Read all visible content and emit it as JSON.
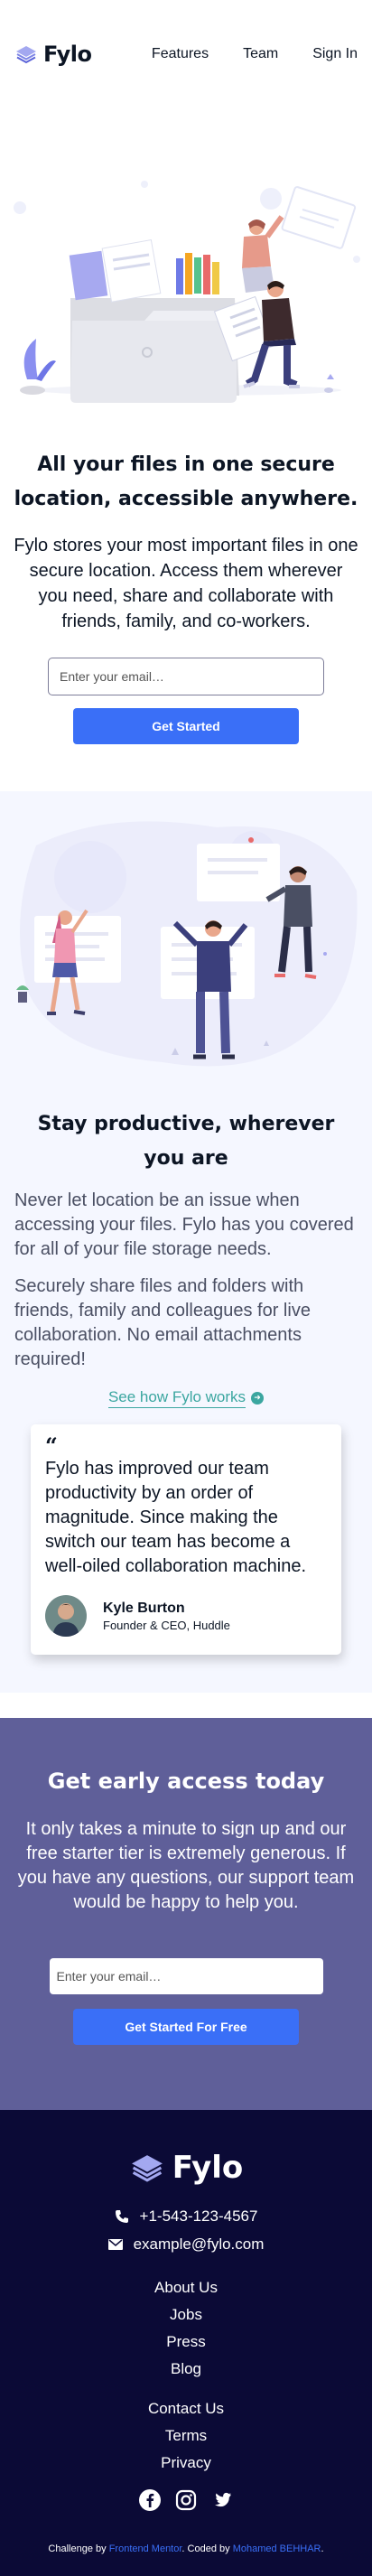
{
  "header": {
    "logo_text": "Fylo",
    "nav": [
      "Features",
      "Team",
      "Sign In"
    ]
  },
  "hero": {
    "title": "All your files in one secure location, accessible anywhere.",
    "body": "Fylo stores your most important files in one secure location. Access them wherever you need, share and collaborate with friends, family, and co-workers.",
    "email_placeholder": "Enter your email…",
    "cta": "Get Started"
  },
  "productive": {
    "title": "Stay productive, wherever you are",
    "p1": "Never let location be an issue when accessing your files. Fylo has you covered for all of your file storage needs.",
    "p2": "Securely share files and folders with friends, family and colleagues for live collaboration. No email attachments required!",
    "link": "See how Fylo works",
    "testimonial": {
      "quote_mark": "“",
      "quote": "Fylo has improved our team productivity by an order of magnitude. Since making the switch our team has become a well-oiled collaboration machine.",
      "name": "Kyle Burton",
      "role": "Founder & CEO, Huddle"
    }
  },
  "early": {
    "title": "Get early access today",
    "body": "It only takes a minute to sign up and our free starter tier is extremely generous. If you have any questions, our support team would be happy to help you.",
    "email_placeholder": "Enter your email…",
    "cta": "Get Started For Free"
  },
  "footer": {
    "logo_text": "Fylo",
    "phone": "+1-543-123-4567",
    "email": "example@fylo.com",
    "links1": [
      "About Us",
      "Jobs",
      "Press",
      "Blog"
    ],
    "links2": [
      "Contact Us",
      "Terms",
      "Privacy"
    ],
    "credit_prefix": "Challenge by ",
    "credit_link1": "Frontend Mentor",
    "credit_middle": ". Coded by ",
    "credit_link2": "Mohamed BEHHAR",
    "credit_suffix": "."
  },
  "colors": {
    "accent_blue": "#3a6ff7",
    "teal": "#3ba6a0",
    "early_bg": "#5f5f99",
    "footer_bg": "#0b0a36"
  }
}
